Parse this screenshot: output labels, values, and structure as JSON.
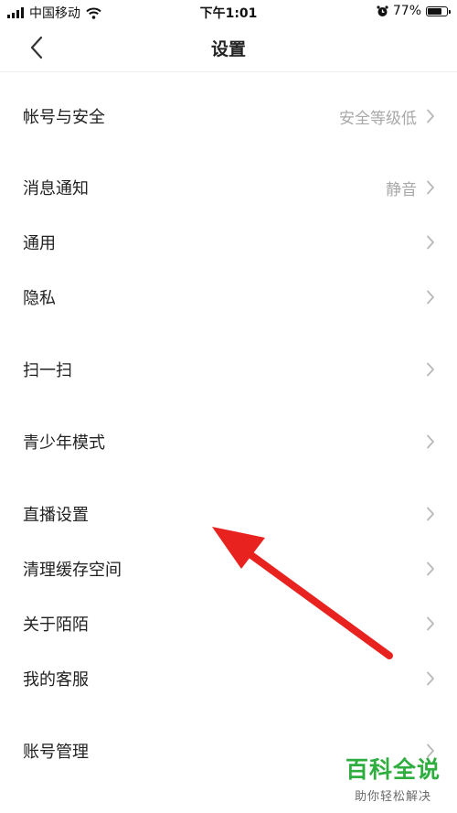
{
  "status_bar": {
    "carrier": "中国移动",
    "time": "下午1:01",
    "battery_percent": "77%",
    "battery_level": 0.77,
    "icons": [
      "signal-icon",
      "wifi-icon",
      "alarm-icon",
      "battery-icon"
    ]
  },
  "header": {
    "back_icon": "chevron-left-icon",
    "title": "设置"
  },
  "settings": [
    {
      "label": "帐号与安全",
      "value": "安全等级低"
    },
    {
      "label": "消息通知",
      "value": "静音"
    },
    {
      "label": "通用",
      "value": ""
    },
    {
      "label": "隐私",
      "value": ""
    },
    {
      "label": "扫一扫",
      "value": ""
    },
    {
      "label": "青少年模式",
      "value": ""
    },
    {
      "label": "直播设置",
      "value": ""
    },
    {
      "label": "清理缓存空间",
      "value": ""
    },
    {
      "label": "关于陌陌",
      "value": ""
    },
    {
      "label": "我的客服",
      "value": ""
    },
    {
      "label": "账号管理",
      "value": ""
    }
  ],
  "overlay": {
    "annotation": "red-arrow-icon",
    "color": "#e8231f"
  },
  "watermark": {
    "title": "百科全说",
    "subtitle": "助你轻松解决",
    "color": "#2fae3f"
  }
}
